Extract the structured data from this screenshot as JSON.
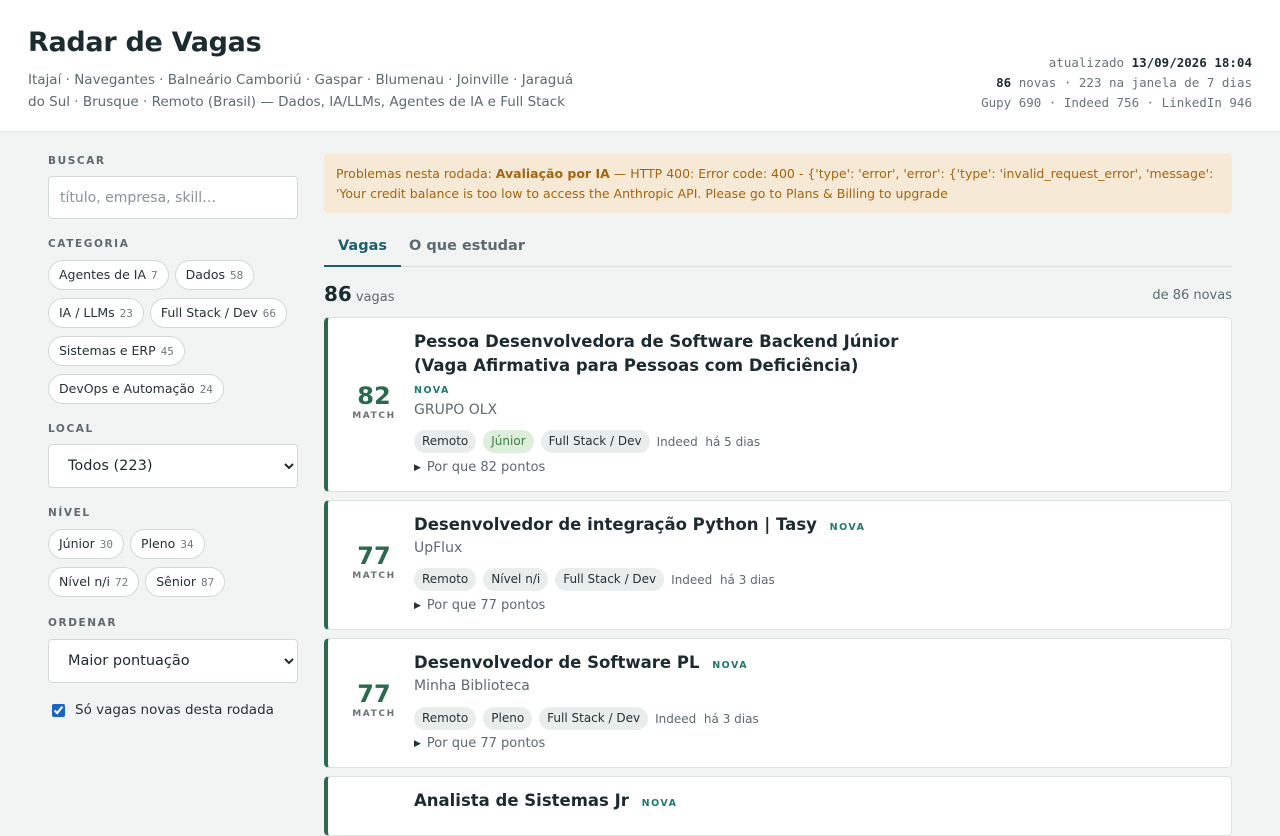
{
  "header": {
    "title": "Radar de Vagas",
    "subtitle": "Itajaí · Navegantes · Balneário Camboriú · Gaspar · Blumenau · Joinville · Jaraguá do Sul · Brusque · Remoto (Brasil) — Dados, IA/LLMs, Agentes de IA e Full Stack",
    "updated_label": "atualizado",
    "updated_value": "13/09/2026 18:04",
    "new_count": "86",
    "new_line_rest": "novas · 223 na janela de 7 dias",
    "sources_line": "Gupy 690 · Indeed 756 · LinkedIn 946"
  },
  "sidebar": {
    "search_label": "BUSCAR",
    "search_placeholder": "título, empresa, skill…",
    "category_label": "CATEGORIA",
    "categories": [
      {
        "label": "Agentes de IA",
        "count": "7"
      },
      {
        "label": "Dados",
        "count": "58"
      },
      {
        "label": "IA / LLMs",
        "count": "23"
      },
      {
        "label": "Full Stack / Dev",
        "count": "66"
      },
      {
        "label": "Sistemas e ERP",
        "count": "45"
      },
      {
        "label": "DevOps e Automação",
        "count": "24"
      }
    ],
    "local_label": "LOCAL",
    "local_selected": "Todos (223)",
    "level_label": "NÍVEL",
    "levels": [
      {
        "label": "Júnior",
        "count": "30"
      },
      {
        "label": "Pleno",
        "count": "34"
      },
      {
        "label": "Nível n/i",
        "count": "72"
      },
      {
        "label": "Sênior",
        "count": "87"
      }
    ],
    "order_label": "ORDENAR",
    "order_selected": "Maior pontuação",
    "only_new_label": "Só vagas novas desta rodada",
    "only_new_checked": true
  },
  "alert": {
    "prefix": "Problemas nesta rodada: ",
    "strong": "Avaliação por IA",
    "message": " — HTTP 400: Error code: 400 - {'type': 'error', 'error': {'type': 'invalid_request_error', 'message': 'Your credit balance is too low to access the Anthropic API. Please go to Plans & Billing to upgrade"
  },
  "tabs": [
    {
      "label": "Vagas",
      "active": true
    },
    {
      "label": "O que estudar",
      "active": false
    }
  ],
  "results": {
    "count": "86",
    "count_label": "vagas",
    "right_label": "de 86 novas"
  },
  "score_label": "MATCH",
  "new_badge": "NOVA",
  "jobs": [
    {
      "score": "82",
      "title_line1": "Pessoa Desenvolvedora de Software Backend Júnior",
      "title_line2": "(Vaga Afirmativa para Pessoas com Deficiência)",
      "company": "GRUPO OLX",
      "tags": [
        "Remoto",
        "Júnior",
        "Full Stack / Dev"
      ],
      "source": "Indeed",
      "age": "há 5 dias",
      "why": "Por que 82 pontos"
    },
    {
      "score": "77",
      "title_line1": "Desenvolvedor de integração Python | Tasy",
      "company": "UpFlux",
      "tags": [
        "Remoto",
        "Nível n/i",
        "Full Stack / Dev"
      ],
      "source": "Indeed",
      "age": "há 3 dias",
      "why": "Por que 77 pontos"
    },
    {
      "score": "77",
      "title_line1": "Desenvolvedor de Software PL",
      "company": "Minha Biblioteca",
      "tags": [
        "Remoto",
        "Pleno",
        "Full Stack / Dev"
      ],
      "source": "Indeed",
      "age": "há 3 dias",
      "why": "Por que 77 pontos"
    },
    {
      "title_line1": "Analista de Sistemas Jr"
    }
  ],
  "colors": {
    "accent": "#1e5f6a",
    "score_green": "#2c6a4e",
    "alert_bg": "#f6e9d6",
    "alert_text": "#a5640f"
  }
}
